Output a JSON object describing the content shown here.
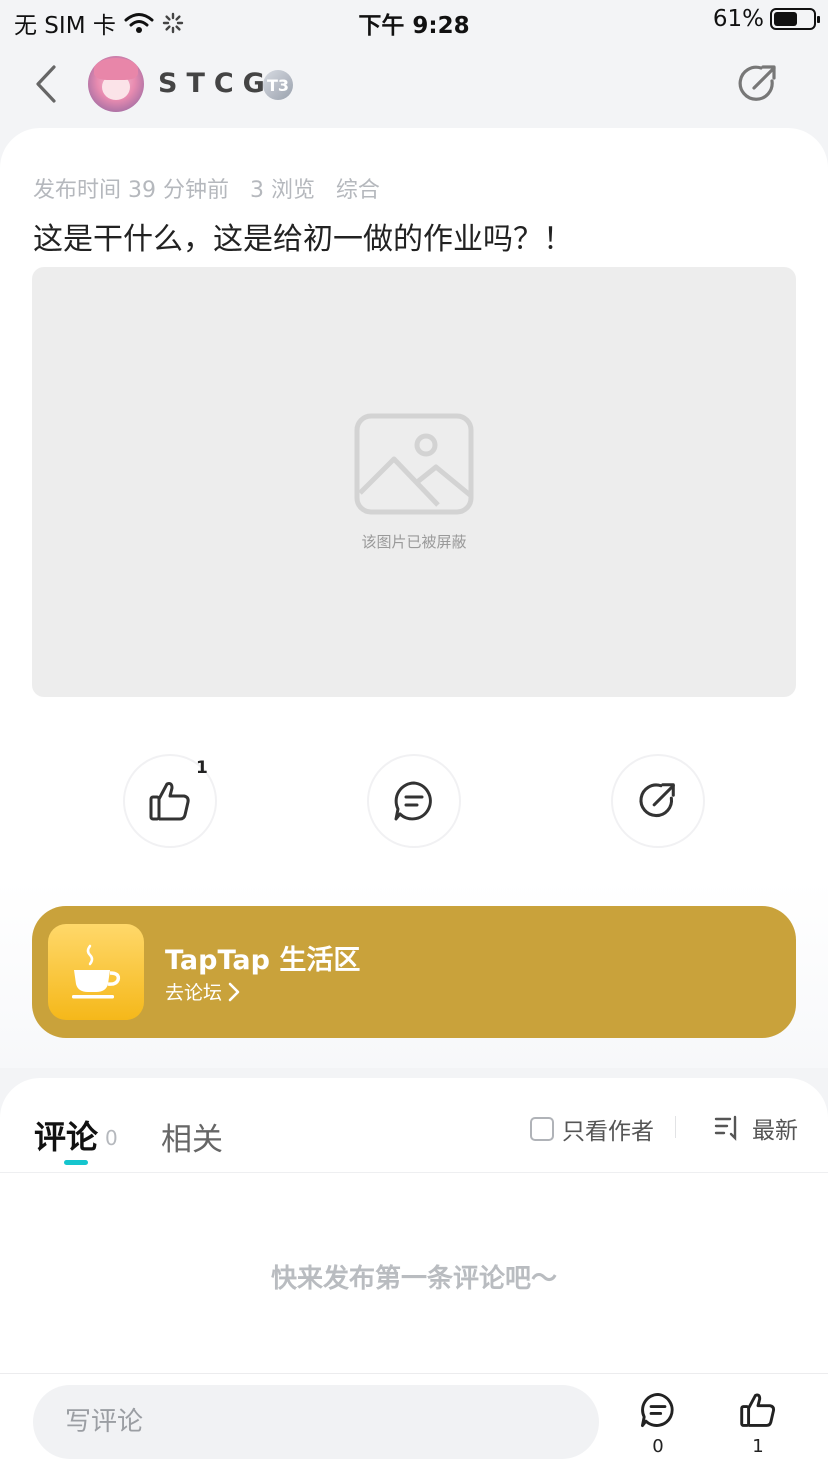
{
  "status_bar": {
    "carrier": "无 SIM 卡",
    "time": "下午 9:28",
    "battery_percent": "61%",
    "battery_level": 0.61
  },
  "header": {
    "username": "STCG",
    "level_badge": "T3",
    "icons": [
      "back-arrow-icon",
      "avatar",
      "share-icon"
    ]
  },
  "post": {
    "meta": "发布时间 39 分钟前   3 浏览   综合",
    "title": "这是干什么，这是给初一做的作业吗？！",
    "blocked_image_text": "该图片已被屏蔽"
  },
  "actions": {
    "like_count": "1",
    "icons": [
      "thumbs-up-icon",
      "comment-icon",
      "share-icon"
    ]
  },
  "banner": {
    "title": "TapTap 生活区",
    "link_label": "去论坛",
    "color": "#c9a23b",
    "icon": "coffee-cup-icon"
  },
  "comments": {
    "tab_comments": "评论",
    "comment_count": "0",
    "tab_related": "相关",
    "author_only_label": "只看作者",
    "sort_label": "最新",
    "empty_text": "快来发布第一条评论吧～",
    "accent_color": "#15c5ce"
  },
  "bottom_bar": {
    "input_placeholder": "写评论",
    "comment_count": "0",
    "like_count": "1"
  }
}
